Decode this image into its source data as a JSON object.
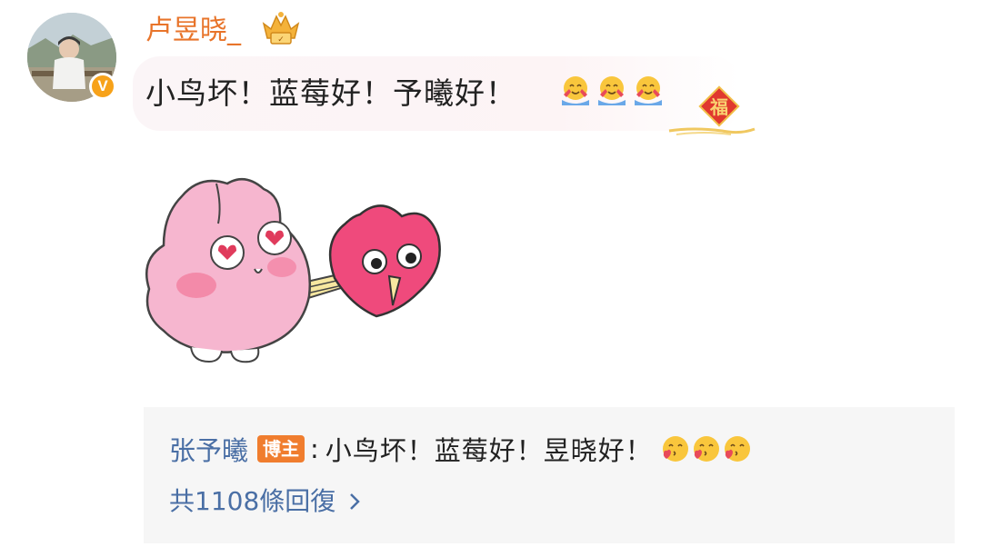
{
  "post": {
    "username": "卢昱晓_",
    "verified_badge": "V",
    "text": "小鸟坏！蓝莓好！予曦好！",
    "inline_emojis": [
      "hug-emoji",
      "hug-emoji",
      "hug-emoji"
    ],
    "decoration": "福"
  },
  "reply": {
    "name": "张予曦",
    "badge": "博主",
    "separator": ":",
    "text": "小鸟坏！蓝莓好！昱晓好！",
    "emojis": [
      "kiss-emoji",
      "kiss-emoji",
      "kiss-emoji"
    ],
    "count_label": "共1108條回復"
  },
  "colors": {
    "username": "#e8742a",
    "link_blue": "#4a6fa5",
    "badge_orange": "#f07d2e",
    "verified_yellow": "#f7a21a"
  }
}
